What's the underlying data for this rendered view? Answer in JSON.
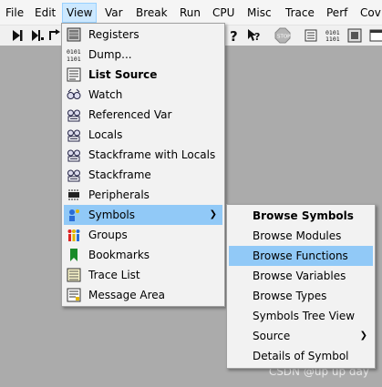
{
  "menubar": {
    "items": [
      "File",
      "Edit",
      "View",
      "Var",
      "Break",
      "Run",
      "CPU",
      "Misc",
      "Trace",
      "Perf",
      "Cov"
    ],
    "open_item": "View"
  },
  "view_menu": {
    "items": [
      {
        "label": "Registers",
        "icon": "registers-icon"
      },
      {
        "label": "Dump...",
        "icon": "dump-icon"
      },
      {
        "label": "List Source",
        "icon": "list-source-icon",
        "bold": true
      },
      {
        "label": "Watch",
        "icon": "watch-icon"
      },
      {
        "label": "Referenced Var",
        "icon": "referenced-var-icon"
      },
      {
        "label": "Locals",
        "icon": "locals-icon"
      },
      {
        "label": "Stackframe with Locals",
        "icon": "stackframe-locals-icon"
      },
      {
        "label": "Stackframe",
        "icon": "stackframe-icon"
      },
      {
        "label": "Peripherals",
        "icon": "peripherals-icon"
      },
      {
        "label": "Symbols",
        "icon": "symbols-icon",
        "submenu": true,
        "highlighted": true
      },
      {
        "label": "Groups",
        "icon": "groups-icon"
      },
      {
        "label": "Bookmarks",
        "icon": "bookmarks-icon"
      },
      {
        "label": "Trace List",
        "icon": "trace-list-icon"
      },
      {
        "label": "Message Area",
        "icon": "message-area-icon"
      }
    ]
  },
  "symbols_menu": {
    "items": [
      {
        "label": "Browse Symbols",
        "bold": true
      },
      {
        "label": "Browse Modules"
      },
      {
        "label": "Browse Functions",
        "highlighted": true
      },
      {
        "label": "Browse Variables"
      },
      {
        "label": "Browse Types"
      },
      {
        "label": "Symbols Tree View"
      },
      {
        "label": "Source",
        "submenu": true
      },
      {
        "label": "Details of Symbol"
      }
    ]
  },
  "watermark": "CSDN @up up day",
  "colors": {
    "workspace": "#ababab",
    "menu_bg": "#f2f2f2",
    "highlight": "#91c9f7",
    "open_menubar_item": "#cce8ff"
  }
}
